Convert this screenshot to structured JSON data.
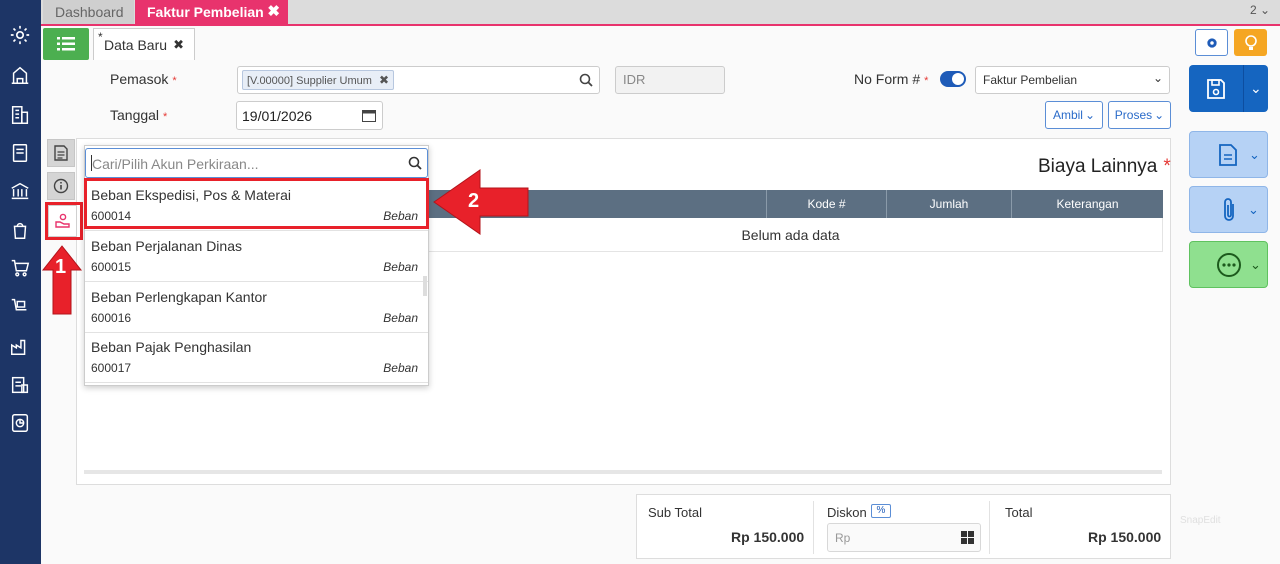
{
  "tabs": [
    {
      "label": "Dashboard"
    },
    {
      "label": "Faktur Pembelian"
    }
  ],
  "tab_counter": "2",
  "subtab": {
    "marker": "*",
    "label": "Data Baru"
  },
  "form": {
    "pemasok_label": "Pemasok",
    "pemasok_value": "[V.00000] Supplier Umum",
    "currency": "IDR",
    "tanggal_label": "Tanggal",
    "tanggal_value": "19/01/2026",
    "no_form_label": "No Form #",
    "form_type": "Faktur Pembelian",
    "ambil_label": "Ambil",
    "proses_label": "Proses"
  },
  "section_title": "Biaya Lainnya",
  "search": {
    "placeholder": "Cari/Pilih Akun Perkiraan..."
  },
  "accounts": [
    {
      "name": "Beban Ekspedisi, Pos & Materai",
      "code": "600014",
      "type": "Beban"
    },
    {
      "name": "Beban Perjalanan Dinas",
      "code": "600015",
      "type": "Beban"
    },
    {
      "name": "Beban Perlengkapan Kantor",
      "code": "600016",
      "type": "Beban"
    },
    {
      "name": "Beban Pajak Penghasilan",
      "code": "600017",
      "type": "Beban"
    }
  ],
  "table": {
    "headers": [
      "Kode #",
      "Jumlah",
      "Keterangan"
    ],
    "empty_text": "Belum ada data"
  },
  "summary": {
    "subtotal_label": "Sub Total",
    "subtotal_value": "Rp 150.000",
    "diskon_label": "Diskon",
    "diskon_badge": "%",
    "diskon_placeholder": "Rp",
    "total_label": "Total",
    "total_value": "Rp 150.000"
  },
  "callouts": {
    "step1": "1",
    "step2": "2"
  },
  "watermark": "SnapEdit",
  "colors": {
    "accent": "#e8336d",
    "sidebar": "#1d3566",
    "highlight": "#e8212a",
    "primary": "#1565c0",
    "success": "#4caf50"
  }
}
